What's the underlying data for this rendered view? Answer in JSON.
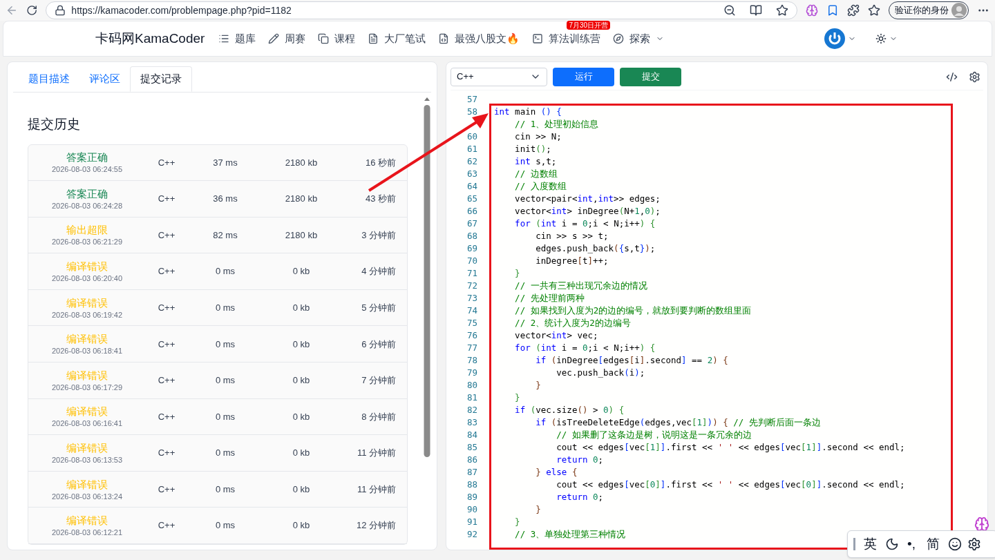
{
  "browser": {
    "url": "https://kamacoder.com/problempage.php?pid=1182",
    "profile_button": "验证你的身份"
  },
  "nav": {
    "logo": "卡码网KamaCoder",
    "items": [
      {
        "kind": "list",
        "label": "题库"
      },
      {
        "kind": "pencil",
        "label": "周赛"
      },
      {
        "kind": "copy",
        "label": "课程"
      },
      {
        "kind": "doc",
        "label": "大厂笔试"
      },
      {
        "kind": "code",
        "label": "最强八股文",
        "suffix": "🔥"
      },
      {
        "kind": "terminal",
        "label": "算法训练营",
        "badge": "7月30日开营"
      },
      {
        "kind": "compass",
        "label": "探索",
        "dropdown": true
      }
    ]
  },
  "left": {
    "tabs": [
      {
        "label": "题目描述",
        "selected": false
      },
      {
        "label": "评论区",
        "selected": false
      },
      {
        "label": "提交记录",
        "selected": true
      }
    ],
    "title": "提交历史",
    "submissions": [
      {
        "status": "答案正确",
        "color": "#198754",
        "date": "2026-08-03 06:24:55",
        "lang": "C++",
        "time": "37 ms",
        "memory": "2180 kb",
        "ago": "16 秒前"
      },
      {
        "status": "答案正确",
        "color": "#198754",
        "date": "2026-08-03 06:24:28",
        "lang": "C++",
        "time": "36 ms",
        "memory": "2180 kb",
        "ago": "43 秒前"
      },
      {
        "status": "输出超限",
        "color": "#ffc107",
        "date": "2026-08-03 06:21:29",
        "lang": "C++",
        "time": "82 ms",
        "memory": "2180 kb",
        "ago": "3 分钟前"
      },
      {
        "status": "编译错误",
        "color": "#ffc107",
        "date": "2026-08-03 06:20:40",
        "lang": "C++",
        "time": "0 ms",
        "memory": "0 kb",
        "ago": "4 分钟前"
      },
      {
        "status": "编译错误",
        "color": "#ffc107",
        "date": "2026-08-03 06:19:42",
        "lang": "C++",
        "time": "0 ms",
        "memory": "0 kb",
        "ago": "5 分钟前"
      },
      {
        "status": "编译错误",
        "color": "#ffc107",
        "date": "2026-08-03 06:18:41",
        "lang": "C++",
        "time": "0 ms",
        "memory": "0 kb",
        "ago": "6 分钟前"
      },
      {
        "status": "编译错误",
        "color": "#ffc107",
        "date": "2026-08-03 06:17:29",
        "lang": "C++",
        "time": "0 ms",
        "memory": "0 kb",
        "ago": "7 分钟前"
      },
      {
        "status": "编译错误",
        "color": "#ffc107",
        "date": "2026-08-03 06:16:41",
        "lang": "C++",
        "time": "0 ms",
        "memory": "0 kb",
        "ago": "8 分钟前"
      },
      {
        "status": "编译错误",
        "color": "#ffc107",
        "date": "2026-08-03 06:13:53",
        "lang": "C++",
        "time": "0 ms",
        "memory": "0 kb",
        "ago": "11 分钟前"
      },
      {
        "status": "编译错误",
        "color": "#ffc107",
        "date": "2026-08-03 06:13:24",
        "lang": "C++",
        "time": "0 ms",
        "memory": "0 kb",
        "ago": "11 分钟前"
      },
      {
        "status": "编译错误",
        "color": "#ffc107",
        "date": "2026-08-03 06:12:21",
        "lang": "C++",
        "time": "0 ms",
        "memory": "0 kb",
        "ago": "12 分钟前"
      }
    ]
  },
  "editor": {
    "language": "C++",
    "run_button": "运行",
    "submit_button": "提交",
    "lines": [
      {
        "no": "57"
      },
      {
        "no": "58",
        "tokens": [
          {
            "kind": "kw",
            "text": "int"
          },
          {
            "kind": "p",
            "text": " main "
          },
          {
            "kind": "b1",
            "text": "() {"
          }
        ]
      },
      {
        "tokens": [
          {
            "kind": "cm",
            "text": "    // 1、处理初始信息"
          }
        ]
      },
      {
        "no": "60",
        "tokens": [
          {
            "kind": "p",
            "text": "    cin >> N;"
          }
        ]
      },
      {
        "no": "61",
        "tokens": [
          {
            "kind": "p",
            "text": "    init"
          },
          {
            "kind": "b2",
            "text": "()"
          },
          {
            "kind": "p",
            "text": ";"
          }
        ]
      },
      {
        "no": "62",
        "tokens": [
          {
            "kind": "kw",
            "text": "    int"
          },
          {
            "kind": "p",
            "text": " s,t;"
          }
        ]
      },
      {
        "no": "63",
        "tokens": [
          {
            "kind": "cm",
            "text": "    // 边数组"
          }
        ]
      },
      {
        "no": "64",
        "tokens": [
          {
            "kind": "cm",
            "text": "    // 入度数组"
          }
        ]
      },
      {
        "no": "65",
        "tokens": [
          {
            "kind": "p",
            "text": "    vector<pair<"
          },
          {
            "kind": "kw",
            "text": "int"
          },
          {
            "kind": "p",
            "text": ","
          },
          {
            "kind": "kw",
            "text": "int"
          },
          {
            "kind": "p",
            "text": ">> edges;"
          }
        ]
      },
      {
        "no": "66",
        "tokens": [
          {
            "kind": "p",
            "text": "    vector<"
          },
          {
            "kind": "kw",
            "text": "int"
          },
          {
            "kind": "p",
            "text": "> inDegree"
          },
          {
            "kind": "b2",
            "text": "("
          },
          {
            "kind": "p",
            "text": "N+"
          },
          {
            "kind": "num",
            "text": "1"
          },
          {
            "kind": "p",
            "text": ","
          },
          {
            "kind": "num",
            "text": "0"
          },
          {
            "kind": "b2",
            "text": ")"
          },
          {
            "kind": "p",
            "text": ";"
          }
        ]
      },
      {
        "no": "67",
        "tokens": [
          {
            "kind": "kw",
            "text": "    for"
          },
          {
            "kind": "b2",
            "text": " ("
          },
          {
            "kind": "kw",
            "text": "int"
          },
          {
            "kind": "p",
            "text": " i = "
          },
          {
            "kind": "num",
            "text": "0"
          },
          {
            "kind": "p",
            "text": ";i < N;i++"
          },
          {
            "kind": "b2",
            "text": ") {"
          }
        ]
      },
      {
        "no": "68",
        "tokens": [
          {
            "kind": "p",
            "text": "        cin >> s >> t;"
          }
        ]
      },
      {
        "no": "69",
        "tokens": [
          {
            "kind": "p",
            "text": "        edges.push_back"
          },
          {
            "kind": "b3",
            "text": "("
          },
          {
            "kind": "b1",
            "text": "{"
          },
          {
            "kind": "p",
            "text": "s,t"
          },
          {
            "kind": "b1",
            "text": "}"
          },
          {
            "kind": "b3",
            "text": ")"
          },
          {
            "kind": "p",
            "text": ";"
          }
        ]
      },
      {
        "no": "70",
        "tokens": [
          {
            "kind": "p",
            "text": "        inDegree"
          },
          {
            "kind": "b3",
            "text": "["
          },
          {
            "kind": "p",
            "text": "t"
          },
          {
            "kind": "b3",
            "text": "]"
          },
          {
            "kind": "p",
            "text": "++;"
          }
        ]
      },
      {
        "no": "71",
        "tokens": [
          {
            "kind": "b2",
            "text": "    }"
          }
        ]
      },
      {
        "no": "72",
        "tokens": [
          {
            "kind": "cm",
            "text": "    // 一共有三种出现冗余边的情况"
          }
        ]
      },
      {
        "no": "73",
        "tokens": [
          {
            "kind": "cm",
            "text": "    // 先处理前两种"
          }
        ]
      },
      {
        "no": "74",
        "tokens": [
          {
            "kind": "cm",
            "text": "    // 如果找到入度为2的边的编号，就放到要判断的数组里面"
          }
        ]
      },
      {
        "no": "75",
        "tokens": [
          {
            "kind": "cm",
            "text": "    // 2、统计入度为2的边编号"
          }
        ]
      },
      {
        "no": "76",
        "tokens": [
          {
            "kind": "p",
            "text": "    vector<"
          },
          {
            "kind": "kw",
            "text": "int"
          },
          {
            "kind": "p",
            "text": "> vec;"
          }
        ]
      },
      {
        "no": "77",
        "tokens": [
          {
            "kind": "kw",
            "text": "    for"
          },
          {
            "kind": "b2",
            "text": " ("
          },
          {
            "kind": "kw",
            "text": "int"
          },
          {
            "kind": "p",
            "text": " i = "
          },
          {
            "kind": "num",
            "text": "0"
          },
          {
            "kind": "p",
            "text": ";i < N;i++"
          },
          {
            "kind": "b2",
            "text": ") {"
          }
        ]
      },
      {
        "no": "78",
        "tokens": [
          {
            "kind": "kw",
            "text": "        if"
          },
          {
            "kind": "b3",
            "text": " ("
          },
          {
            "kind": "p",
            "text": "inDegree"
          },
          {
            "kind": "b1",
            "text": "["
          },
          {
            "kind": "p",
            "text": "edges"
          },
          {
            "kind": "b3",
            "text": "["
          },
          {
            "kind": "p",
            "text": "i"
          },
          {
            "kind": "b3",
            "text": "]"
          },
          {
            "kind": "p",
            "text": ".second"
          },
          {
            "kind": "b1",
            "text": "]"
          },
          {
            "kind": "p",
            "text": " == "
          },
          {
            "kind": "num",
            "text": "2"
          },
          {
            "kind": "b3",
            "text": ") {"
          }
        ]
      },
      {
        "no": "79",
        "tokens": [
          {
            "kind": "p",
            "text": "            vec.push_back"
          },
          {
            "kind": "b1",
            "text": "("
          },
          {
            "kind": "p",
            "text": "i"
          },
          {
            "kind": "b1",
            "text": ")"
          },
          {
            "kind": "p",
            "text": ";"
          }
        ]
      },
      {
        "no": "80",
        "tokens": [
          {
            "kind": "b3",
            "text": "        }"
          }
        ]
      },
      {
        "no": "81",
        "tokens": [
          {
            "kind": "b2",
            "text": "    }"
          }
        ]
      },
      {
        "no": "82",
        "tokens": [
          {
            "kind": "kw",
            "text": "    if"
          },
          {
            "kind": "b2",
            "text": " ("
          },
          {
            "kind": "p",
            "text": "vec.size"
          },
          {
            "kind": "b3",
            "text": "()"
          },
          {
            "kind": "p",
            "text": " > "
          },
          {
            "kind": "num",
            "text": "0"
          },
          {
            "kind": "b2",
            "text": ") {"
          }
        ]
      },
      {
        "no": "83",
        "tokens": [
          {
            "kind": "kw",
            "text": "        if"
          },
          {
            "kind": "b3",
            "text": " ("
          },
          {
            "kind": "p",
            "text": "isTreeDeleteEdge"
          },
          {
            "kind": "b1",
            "text": "("
          },
          {
            "kind": "p",
            "text": "edges,vec"
          },
          {
            "kind": "b2",
            "text": "["
          },
          {
            "kind": "num",
            "text": "1"
          },
          {
            "kind": "b2",
            "text": "]"
          },
          {
            "kind": "b1",
            "text": ")"
          },
          {
            "kind": "b3",
            "text": ") {"
          },
          {
            "kind": "cm",
            "text": " // 先判断后面一条边"
          }
        ]
      },
      {
        "no": "84",
        "tokens": [
          {
            "kind": "cm",
            "text": "            // 如果删了这条边是树，说明这是一条冗余的边"
          }
        ]
      },
      {
        "no": "85",
        "tokens": [
          {
            "kind": "p",
            "text": "            cout << edges"
          },
          {
            "kind": "b1",
            "text": "["
          },
          {
            "kind": "p",
            "text": "vec"
          },
          {
            "kind": "b2",
            "text": "["
          },
          {
            "kind": "num",
            "text": "1"
          },
          {
            "kind": "b2",
            "text": "]"
          },
          {
            "kind": "b1",
            "text": "]"
          },
          {
            "kind": "p",
            "text": ".first << "
          },
          {
            "kind": "str",
            "text": "' '"
          },
          {
            "kind": "p",
            "text": " << edges"
          },
          {
            "kind": "b1",
            "text": "["
          },
          {
            "kind": "p",
            "text": "vec"
          },
          {
            "kind": "b2",
            "text": "["
          },
          {
            "kind": "num",
            "text": "1"
          },
          {
            "kind": "b2",
            "text": "]"
          },
          {
            "kind": "b1",
            "text": "]"
          },
          {
            "kind": "p",
            "text": ".second << endl;"
          }
        ]
      },
      {
        "no": "86",
        "tokens": [
          {
            "kind": "kw",
            "text": "            return"
          },
          {
            "kind": "num",
            "text": " 0"
          },
          {
            "kind": "p",
            "text": ";"
          }
        ]
      },
      {
        "no": "87",
        "tokens": [
          {
            "kind": "b3",
            "text": "        }"
          },
          {
            "kind": "kw",
            "text": " else"
          },
          {
            "kind": "b3",
            "text": " {"
          }
        ]
      },
      {
        "no": "88",
        "tokens": [
          {
            "kind": "p",
            "text": "            cout << edges"
          },
          {
            "kind": "b1",
            "text": "["
          },
          {
            "kind": "p",
            "text": "vec"
          },
          {
            "kind": "b2",
            "text": "["
          },
          {
            "kind": "num",
            "text": "0"
          },
          {
            "kind": "b2",
            "text": "]"
          },
          {
            "kind": "b1",
            "text": "]"
          },
          {
            "kind": "p",
            "text": ".first << "
          },
          {
            "kind": "str",
            "text": "' '"
          },
          {
            "kind": "p",
            "text": " << edges"
          },
          {
            "kind": "b1",
            "text": "["
          },
          {
            "kind": "p",
            "text": "vec"
          },
          {
            "kind": "b2",
            "text": "["
          },
          {
            "kind": "num",
            "text": "0"
          },
          {
            "kind": "b2",
            "text": "]"
          },
          {
            "kind": "b1",
            "text": "]"
          },
          {
            "kind": "p",
            "text": ".second << endl;"
          }
        ]
      },
      {
        "no": "89",
        "tokens": [
          {
            "kind": "kw",
            "text": "            return"
          },
          {
            "kind": "num",
            "text": " 0"
          },
          {
            "kind": "p",
            "text": ";"
          }
        ]
      },
      {
        "no": "90",
        "tokens": [
          {
            "kind": "b3",
            "text": "        }"
          }
        ]
      },
      {
        "no": "91",
        "tokens": [
          {
            "kind": "b2",
            "text": "    }"
          }
        ]
      },
      {
        "no": "92",
        "tokens": [
          {
            "kind": "cm",
            "text": "    // 3、单独处理第三种情况"
          }
        ]
      }
    ]
  },
  "ime": {
    "items": [
      {
        "kind": "text",
        "label": "英"
      },
      {
        "kind": "moon"
      },
      {
        "kind": "text",
        "label": "•,"
      },
      {
        "kind": "text",
        "label": "简"
      },
      {
        "kind": "smile"
      },
      {
        "kind": "gear"
      }
    ]
  }
}
